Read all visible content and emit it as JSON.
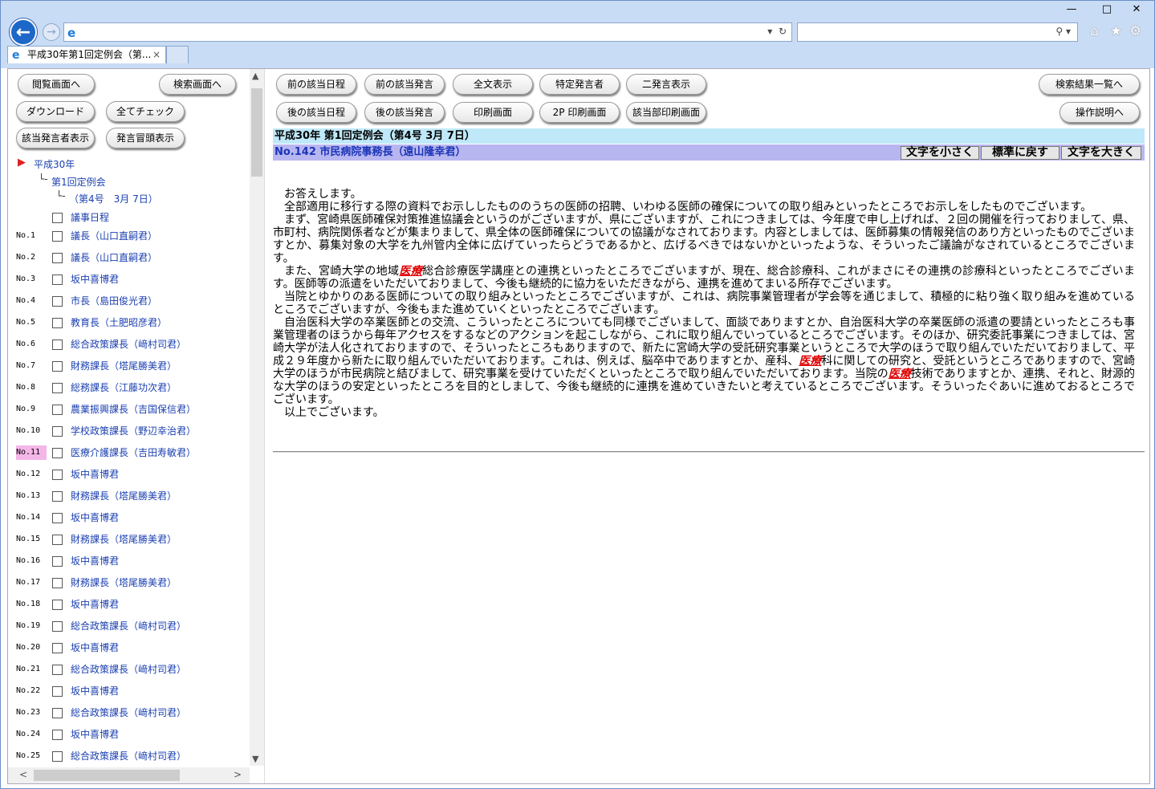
{
  "browser": {
    "address": "",
    "search": "",
    "tab_title": "平成30年第1回定例会（第...",
    "tab_close": "×"
  },
  "left": {
    "buttons": {
      "view": "閲覧画面へ",
      "search": "検索画面へ",
      "download": "ダウンロード",
      "check_all": "全てチェック",
      "show_speakers": "該当発言者表示",
      "show_opening": "発言冒頭表示"
    },
    "tree": {
      "year": "平成30年",
      "session": "第1回定例会",
      "issue": "（第4号　3月 7日）",
      "agenda": "議事日程"
    },
    "items": [
      {
        "no": "No.1",
        "name": "議長（山口直嗣君）"
      },
      {
        "no": "No.2",
        "name": "議長（山口直嗣君）"
      },
      {
        "no": "No.3",
        "name": "坂中喜博君"
      },
      {
        "no": "No.4",
        "name": "市長（島田俊光君）"
      },
      {
        "no": "No.5",
        "name": "教育長（土肥昭彦君）"
      },
      {
        "no": "No.6",
        "name": "総合政策課長（﨑村司君）"
      },
      {
        "no": "No.7",
        "name": "財務課長（塔尾勝美君）"
      },
      {
        "no": "No.8",
        "name": "総務課長（江藤功次君）"
      },
      {
        "no": "No.9",
        "name": "農業振興課長（吉国保信君）"
      },
      {
        "no": "No.10",
        "name": "学校政策課長（野辺幸治君）"
      },
      {
        "no": "No.11",
        "name": "医療介護課長（吉田寿敏君）"
      },
      {
        "no": "No.12",
        "name": "坂中喜博君"
      },
      {
        "no": "No.13",
        "name": "財務課長（塔尾勝美君）"
      },
      {
        "no": "No.14",
        "name": "坂中喜博君"
      },
      {
        "no": "No.15",
        "name": "財務課長（塔尾勝美君）"
      },
      {
        "no": "No.16",
        "name": "坂中喜博君"
      },
      {
        "no": "No.17",
        "name": "財務課長（塔尾勝美君）"
      },
      {
        "no": "No.18",
        "name": "坂中喜博君"
      },
      {
        "no": "No.19",
        "name": "総合政策課長（﨑村司君）"
      },
      {
        "no": "No.20",
        "name": "坂中喜博君"
      },
      {
        "no": "No.21",
        "name": "総合政策課長（﨑村司君）"
      },
      {
        "no": "No.22",
        "name": "坂中喜博君"
      },
      {
        "no": "No.23",
        "name": "総合政策課長（﨑村司君）"
      },
      {
        "no": "No.24",
        "name": "坂中喜博君"
      },
      {
        "no": "No.25",
        "name": "総合政策課長（﨑村司君）"
      }
    ]
  },
  "right": {
    "buttons": {
      "prev_date": "前の該当日程",
      "prev_speech": "前の該当発言",
      "full_text": "全文表示",
      "specific_speaker": "特定発言者",
      "two_speeches": "二発言表示",
      "results_list": "検索結果一覧へ",
      "next_date": "後の該当日程",
      "next_speech": "後の該当発言",
      "print": "印刷画面",
      "print_2p": "2P 印刷画面",
      "print_section": "該当部印刷画面",
      "help": "操作説明へ"
    },
    "header_session": "平成30年 第1回定例会（第4号 3月 7日）",
    "header_speaker": "No.142 市民病院事務長（遠山隆幸君）",
    "size_buttons": {
      "smaller": "文字を小さく",
      "reset": "標準に戻す",
      "larger": "文字を大きく"
    },
    "body": {
      "p1": "お答えします。",
      "p2": "全部適用に移行する際の資料でお示ししたもののうちの医師の招聘、いわゆる医師の確保についての取り組みといったところでお示しをしたものでございます。",
      "p3": "まず、宮崎県医師確保対策推進協議会というのがございますが、県にございますが、これにつきましては、今年度で申し上げれば、２回の開催を行っておりまして、県、市町村、病院関係者などが集まりまして、県全体の医師確保についての協議がなされております。内容としましては、医師募集の情報発信のあり方といったものでございますとか、募集対象の大学を九州管内全体に広げていったらどうであるかと、広げるべきではないかといったような、そういったご議論がなされているところでございます。",
      "p4a": "また、宮崎大学の地域",
      "hl": "医療",
      "p4b": "総合診療医学講座との連携といったところでございますが、現在、総合診療科、これがまさにその連携の診療科といったところでございます。医師等の派遣をいただいておりまして、今後も継続的に協力をいただきながら、連携を進めてまいる所存でございます。",
      "p5": "当院とゆかりのある医師についての取り組みといったところでございますが、これは、病院事業管理者が学会等を通じまして、積極的に粘り強く取り組みを進めているところでございますが、今後もまた進めていくといったところでございます。",
      "p6a": "自治医科大学の卒業医師との交流、こういったところについても同様でございまして、面談でありますとか、自治医科大学の卒業医師の派遣の要請といったところも事業管理者のほうから毎年アクセスをするなどのアクションを起こしながら、これに取り組んでいっているところでございます。そのほか、研究委託事業につきましては、宮崎大学が法人化されておりますので、そういったところもありますので、新たに宮崎大学の受託研究事業というところで大学のほうで取り組んでいただいておりまして、平成２９年度から新たに取り組んでいただいております。これは、例えば、脳卒中でありますとか、産科、",
      "p6b": "科に関しての研究と、受託というところでありますので、宮崎大学のほうが市民病院と結びまして、研究事業を受けていただくといったところで取り組んでいただいております。当院の",
      "p6c": "技術でありますとか、連携、それと、財源的な大学のほうの安定といったところを目的としまして、今後も継続的に連携を進めていきたいと考えているところでございます。そういったぐあいに進めておるところでございます。",
      "p7": "以上でございます。"
    }
  },
  "colors": {
    "selected_no": "#f4b6e8",
    "header_session_bg": "#bfe8f8",
    "header_speaker_bg": "#b8b6f0",
    "highlight": "#e00000"
  }
}
